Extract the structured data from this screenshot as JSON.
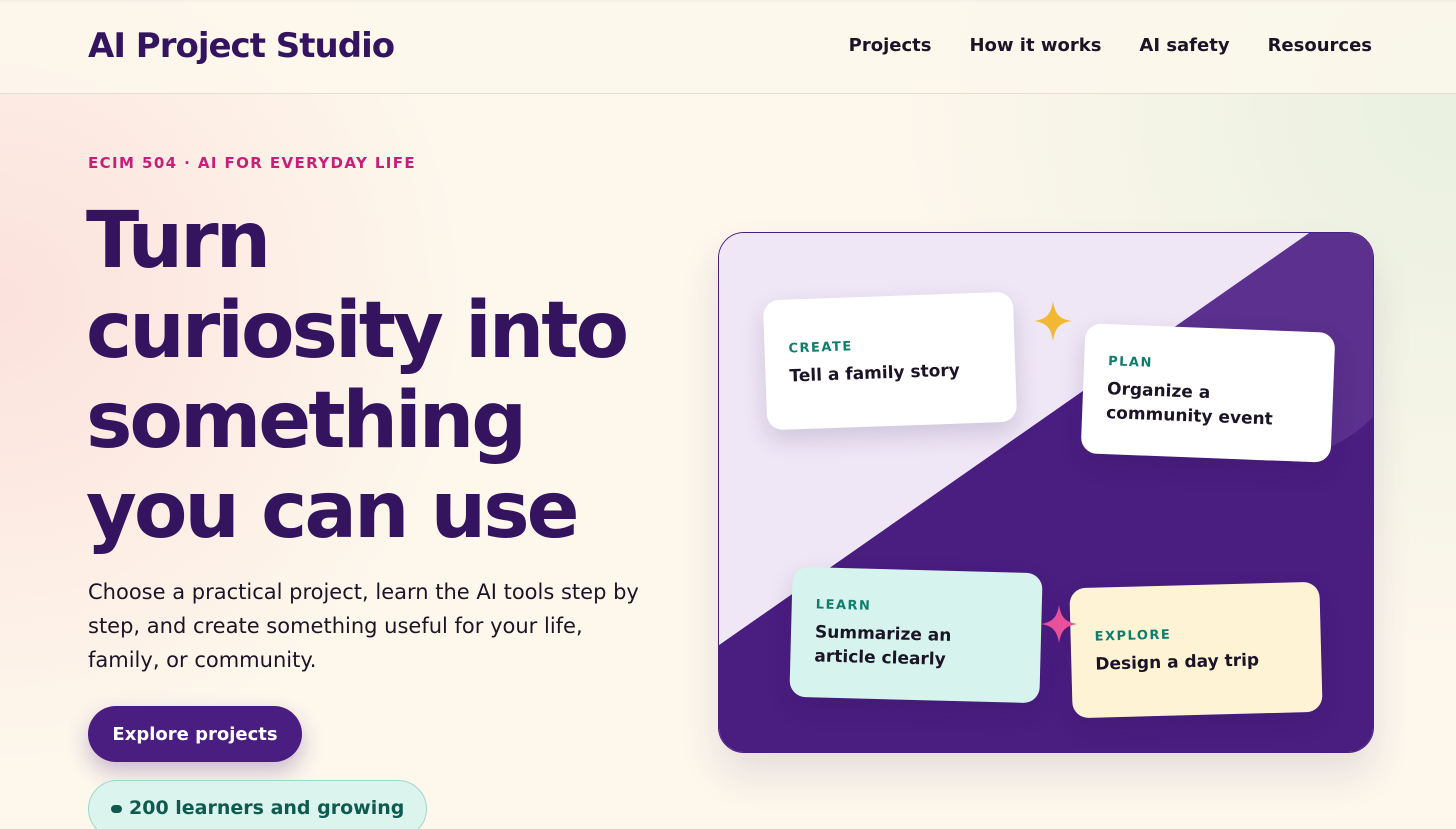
{
  "header": {
    "brand": "AI Project Studio",
    "nav": [
      "Projects",
      "How it works",
      "AI safety",
      "Resources"
    ]
  },
  "hero": {
    "eyebrow": "ECIM 504 · AI FOR EVERYDAY LIFE",
    "headline_lines": [
      "Turn",
      "curiosity into",
      "something",
      "you can use"
    ],
    "subcopy": "Choose a practical project, learn the AI tools step by step, and create something useful for your life, family, or community.",
    "cta_label": "Explore projects",
    "badge_label": "200 learners and growing"
  },
  "illustration": {
    "cards": [
      {
        "kicker": "CREATE",
        "title": "Tell a family story"
      },
      {
        "kicker": "PLAN",
        "title": "Organize a community event"
      },
      {
        "kicker": "LEARN",
        "title": "Summarize an article clearly"
      },
      {
        "kicker": "EXPLORE",
        "title": "Design a day trip"
      }
    ],
    "icons": [
      "sparkle-yellow-icon",
      "sparkle-pink-icon"
    ]
  },
  "colors": {
    "brand_purple": "#34145f",
    "panel_purple": "#4a1d80",
    "accent_pink": "#c81e79",
    "accent_teal": "#0e7d6c",
    "sparkle_yellow": "#f2b833",
    "sparkle_pink": "#e8509a"
  }
}
